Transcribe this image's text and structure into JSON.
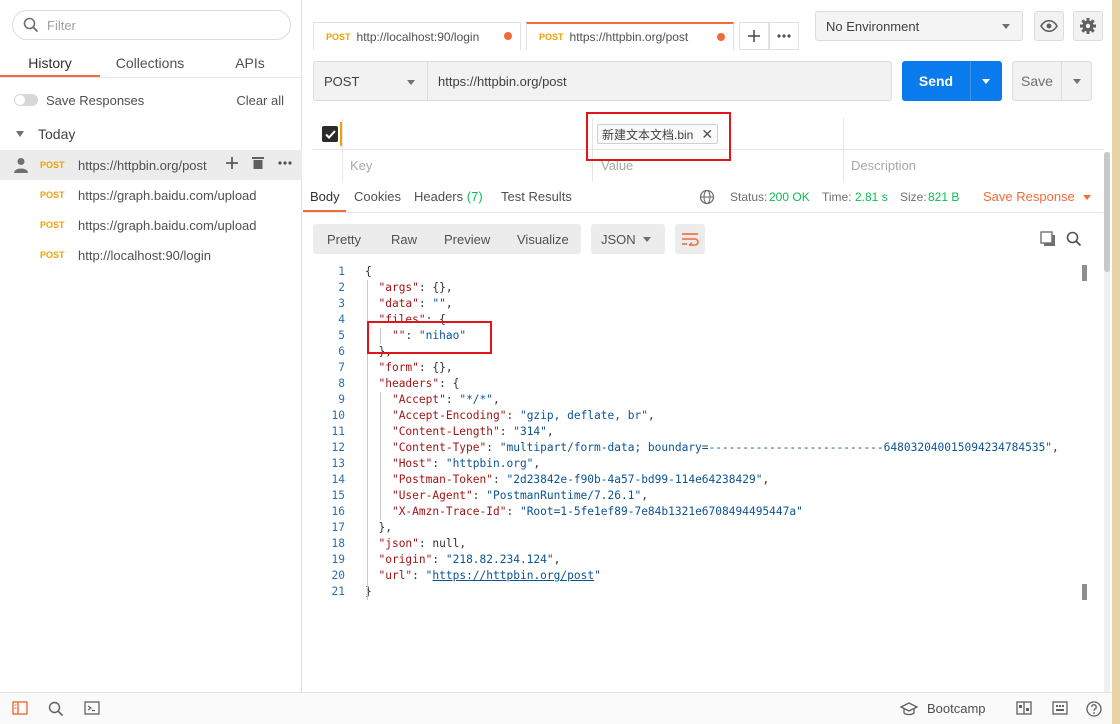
{
  "sidebar": {
    "filter_placeholder": "Filter",
    "tabs": [
      "History",
      "Collections",
      "APIs"
    ],
    "save_responses": "Save Responses",
    "clear_all": "Clear all",
    "group": "Today",
    "history": [
      {
        "method": "POST",
        "url": "https://httpbin.org/post"
      },
      {
        "method": "POST",
        "url": "https://graph.baidu.com/upload"
      },
      {
        "method": "POST",
        "url": "https://graph.baidu.com/upload"
      },
      {
        "method": "POST",
        "url": "http://localhost:90/login"
      }
    ]
  },
  "tabs": [
    {
      "method": "POST",
      "url": "http://localhost:90/login"
    },
    {
      "method": "POST",
      "url": "https://httpbin.org/post"
    }
  ],
  "environment": "No Environment",
  "request": {
    "method": "POST",
    "url": "https://httpbin.org/post",
    "send_label": "Send",
    "save_label": "Save"
  },
  "params": {
    "file_name": "新建文本文档.bin",
    "key_placeholder": "Key",
    "value_placeholder": "Value",
    "description_placeholder": "Description"
  },
  "response": {
    "tabs": {
      "body": "Body",
      "cookies": "Cookies",
      "headers": "Headers",
      "headers_count": "(7)",
      "test_results": "Test Results"
    },
    "status_label": "Status:",
    "status_value": "200 OK",
    "time_label": "Time:",
    "time_value": "2.81 s",
    "size_label": "Size:",
    "size_value": "821 B",
    "save_response": "Save Response",
    "view_modes": [
      "Pretty",
      "Raw",
      "Preview",
      "Visualize"
    ],
    "format": "JSON",
    "lines": [
      "{",
      "  \"args\": {},",
      "  \"data\": \"\",",
      "  \"files\": {",
      "    \"\": \"nihao\"",
      "  },",
      "  \"form\": {},",
      "  \"headers\": {",
      "    \"Accept\": \"*/*\",",
      "    \"Accept-Encoding\": \"gzip, deflate, br\",",
      "    \"Content-Length\": \"314\",",
      "    \"Content-Type\": \"multipart/form-data; boundary=--------------------------648032040015094234784535\",",
      "    \"Host\": \"httpbin.org\",",
      "    \"Postman-Token\": \"2d23842e-f90b-4a57-bd99-114e64238429\",",
      "    \"User-Agent\": \"PostmanRuntime/7.26.1\",",
      "    \"X-Amzn-Trace-Id\": \"Root=1-5fe1ef89-7e84b1321e6708494495447a\"",
      "  },",
      "  \"json\": null,",
      "  \"origin\": \"218.82.234.124\",",
      "  \"url\": \"https://httpbin.org/post\"",
      "}"
    ]
  },
  "statusbar": {
    "bootcamp": "Bootcamp"
  }
}
